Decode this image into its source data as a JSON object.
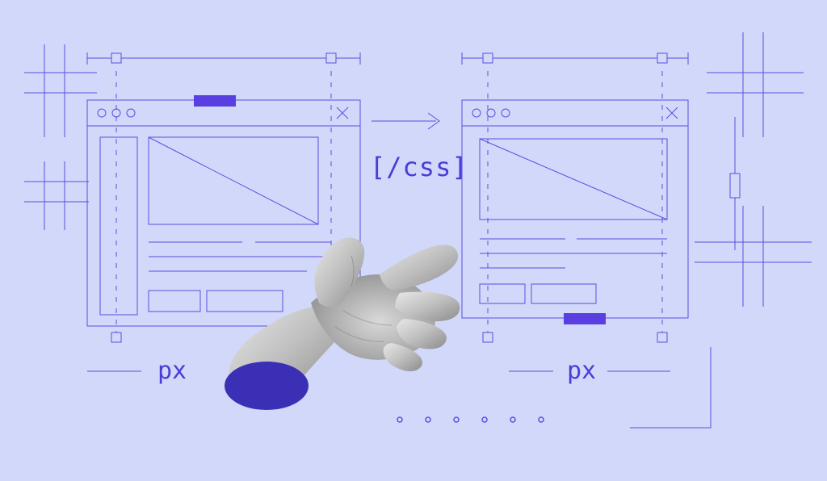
{
  "illustration": {
    "css_tag": "[/css]",
    "unit_left": "px",
    "unit_right": "px"
  }
}
